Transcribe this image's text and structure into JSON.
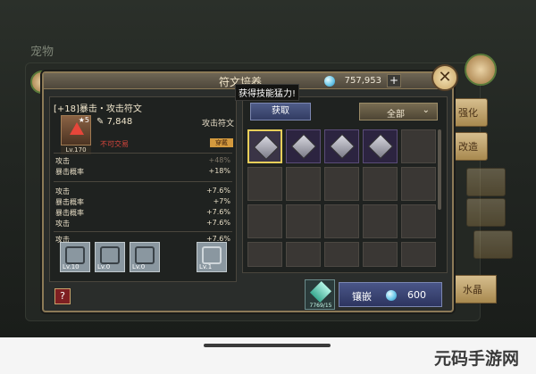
{
  "background": {
    "title": "宠物"
  },
  "side_tabs": {
    "enhance": "强化",
    "modify": "改造",
    "crystal": "水晶"
  },
  "dialog": {
    "title": "符文培养",
    "currency": {
      "icon": "diamond-icon",
      "value": "757,953",
      "add": "+"
    },
    "close": "✕"
  },
  "rune": {
    "name": "[+18]暴击・攻击符文",
    "star": "5",
    "power": "7,848",
    "type": "攻击符文",
    "level": "Lv.170",
    "no_trade": "不可交易",
    "equip_tag": "穿戴",
    "main_stats": [
      {
        "name": "攻击",
        "value": "+48%"
      },
      {
        "name": "暴击概率",
        "value": "+18%"
      }
    ],
    "sub_stats": [
      {
        "name": "攻击",
        "value": "+7.6%"
      },
      {
        "name": "暴击概率",
        "value": "+7%"
      },
      {
        "name": "暴击概率",
        "value": "+7.6%"
      },
      {
        "name": "攻击",
        "value": "+7.6%"
      }
    ],
    "extra_stats": [
      {
        "name": "攻击",
        "value": "+7.6%"
      }
    ],
    "skills": [
      {
        "level": "Lv.10"
      },
      {
        "level": "Lv.0"
      },
      {
        "level": "Lv.0"
      }
    ],
    "weapon_slot": {
      "level": "Lv.1"
    }
  },
  "list": {
    "tab_acquire": "获取",
    "filter": "全部",
    "tooltip": "获得技能猛力!"
  },
  "inlay": {
    "crystal_count": "7769/15",
    "label": "镶嵌",
    "cost": "600"
  },
  "help": "?",
  "watermark": "元码手游网"
}
